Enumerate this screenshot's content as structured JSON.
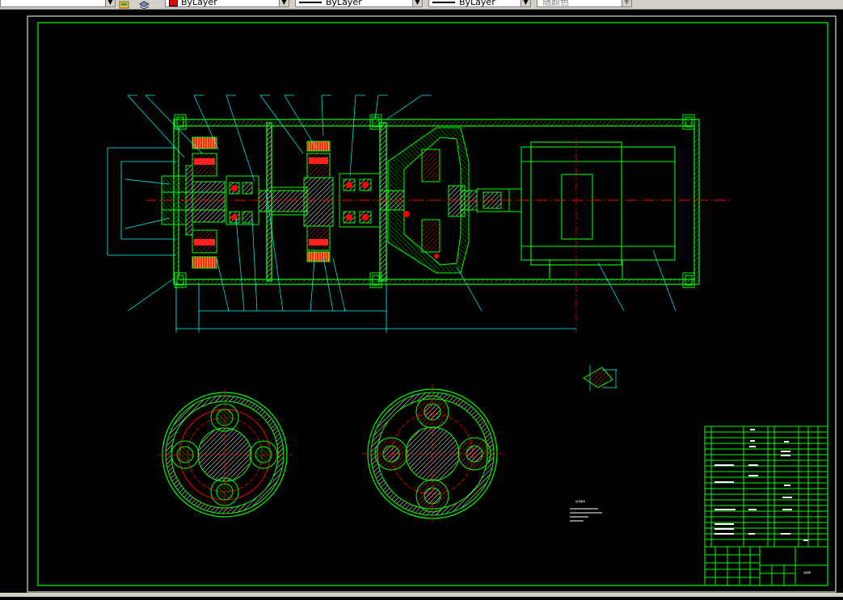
{
  "toolbar": {
    "color_combo": {
      "value": "ByLayer",
      "color": "#e00000"
    },
    "linetype_combo": {
      "value": "ByLayer"
    },
    "lineweight_combo": {
      "value": "ByLayer"
    },
    "plotstyle_combo": {
      "value": "随颜色"
    }
  },
  "colors": {
    "background": "#000000",
    "border": "#00ff00",
    "outline": "#00ff00",
    "center_line": "#ff0000",
    "dimension": "#00ffff",
    "hatch": "#ffffff"
  },
  "drawing": {
    "notes_title": "技术要求",
    "title_block_name": "减速器"
  }
}
